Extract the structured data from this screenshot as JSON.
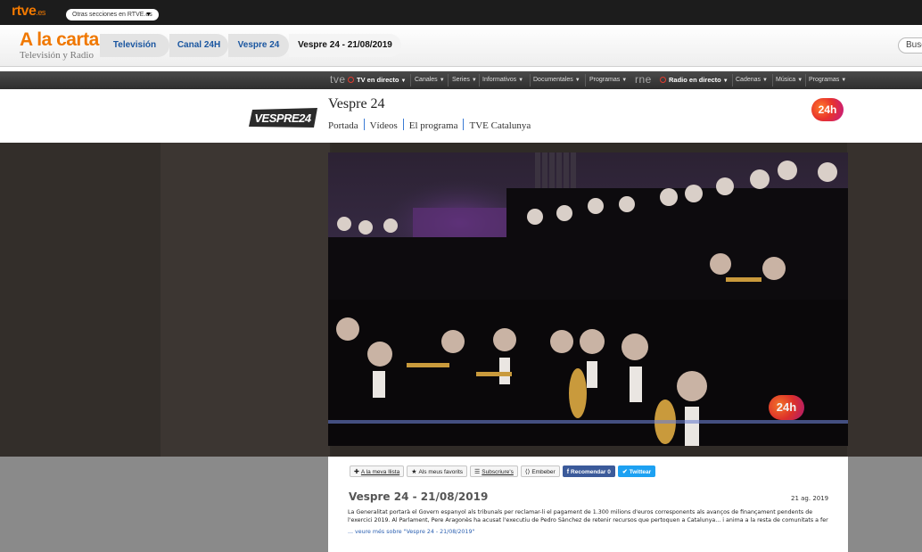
{
  "topbar": {
    "logo": "rtve",
    "logo_suffix": ".es",
    "sections_label": "Otras secciones en RTVE.es",
    "sections_arrow_icon": "caret-down-icon"
  },
  "header": {
    "title": "A la carta",
    "subtitle": "Televisión y Radio",
    "breadcrumbs": [
      "Televisión",
      "Canal 24H",
      "Vespre 24",
      "Vespre 24 - 21/08/2019"
    ],
    "search_placeholder": "Busc"
  },
  "navbar": {
    "tve_brand": "tve",
    "tve_live": "TV en directo",
    "tve_items": [
      "Canales",
      "Series",
      "Informativos",
      "Documentales",
      "Programas"
    ],
    "rne_brand": "rne",
    "rne_live": "Radio en directo",
    "rne_items": [
      "Cadenas",
      "Música",
      "Programas"
    ],
    "caret": "▼"
  },
  "program": {
    "logo_text": "VESPRE24",
    "title": "Vespre 24",
    "nav": [
      "Portada",
      "Vídeos",
      "El programa",
      "TVE Catalunya"
    ],
    "channel_badge": "24h"
  },
  "video": {
    "watermark": "24h"
  },
  "actions": {
    "add_list": "A la meva llista",
    "favorites": "Als meus favorits",
    "subscribe": "Subscriure's",
    "embed": "Embeber",
    "recommend": "Recomendar 0",
    "twitter": "Twittear"
  },
  "episode": {
    "title": "Vespre 24 - 21/08/2019",
    "date": "21 ag. 2019",
    "description": "La Generalitat portarà el Govern espanyol als tribunals per reclamar-li el pagament de 1.300 milions d'euros corresponents als avanços de finançament pendents de l'exercici 2019. Al Parlament, Pere Aragonès ha acusat l'executiu de Pedro Sànchez de retenir recursos que pertoquen a Catalunya... i anima a la resta de comunitats a fer",
    "more_link": "... veure més sobre \"Vespre 24 - 21/08/2019\""
  }
}
